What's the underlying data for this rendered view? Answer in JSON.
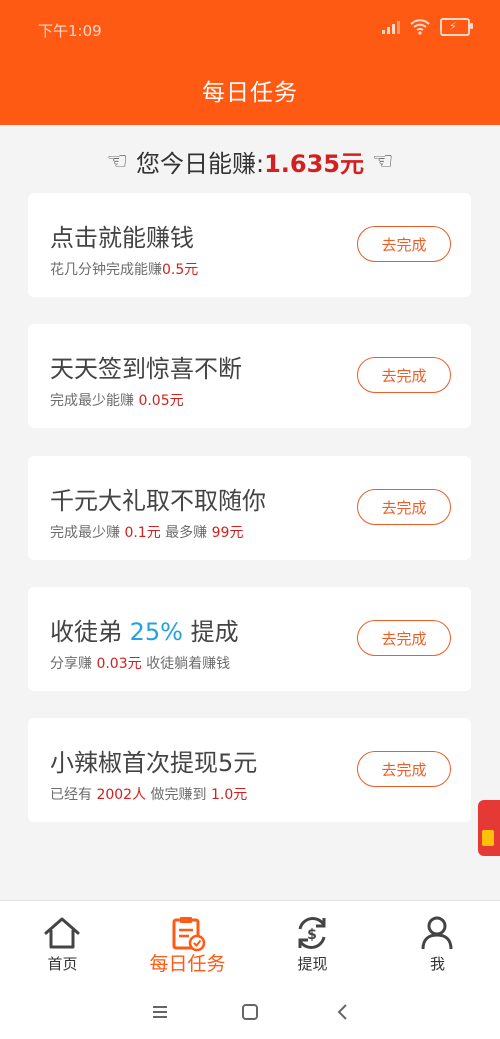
{
  "statusbar": {
    "time": "下午1:09"
  },
  "header": {
    "title": "每日任务"
  },
  "summary": {
    "label": "您今日能赚:",
    "amount": "1.635元"
  },
  "tasks": [
    {
      "title": "点击就能赚钱",
      "sub_pre": "花几分钟完成能赚",
      "sub_val": "0.5元",
      "button": "去完成"
    },
    {
      "title": "天天签到惊喜不断",
      "sub_pre": "完成最少能赚 ",
      "sub_val": "0.05元",
      "button": "去完成"
    },
    {
      "title": "千元大礼取不取随你",
      "sub_pre": "完成最少赚 ",
      "sub_val": "0.1元",
      "sub_mid": " 最多赚 ",
      "sub_val2": "99元",
      "button": "去完成"
    },
    {
      "title_pre": "收徒弟 ",
      "title_highlight": "25%",
      "title_post": " 提成",
      "sub_pre": "分享赚 ",
      "sub_val": "0.03元",
      "sub_mid": " 收徒躺着赚钱",
      "button": "去完成"
    },
    {
      "title": "小辣椒首次提现5元",
      "sub_pre": "已经有 ",
      "sub_val": "2002人",
      "sub_mid": " 做完赚到 ",
      "sub_val2": "1.0元",
      "button": "去完成"
    }
  ],
  "nav": {
    "home": "首页",
    "tasks": "每日任务",
    "withdraw": "提现",
    "me": "我"
  },
  "colors": {
    "accent": "#ff5a14",
    "red": "#d31f1f",
    "blue": "#22a1e6"
  }
}
